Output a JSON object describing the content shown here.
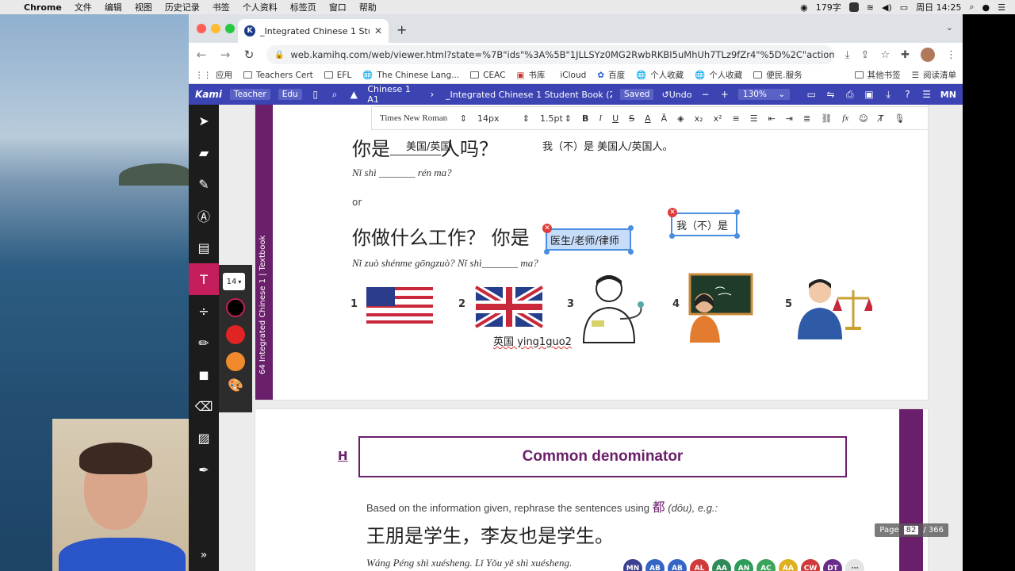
{
  "menubar": {
    "app_name": "Chrome",
    "items": [
      "文件",
      "编辑",
      "视图",
      "历史记录",
      "书签",
      "个人资料",
      "标签页",
      "窗口",
      "帮助"
    ],
    "speed": "179字",
    "clock": "周日 14:25"
  },
  "browser": {
    "tab_title": "_Integrated Chinese 1 Student",
    "url": "web.kamihq.com/web/viewer.html?state=%7B\"ids\"%3A%5B\"1JLLSYz0MG2RwbRKBI5uMhUh7TLz9fZr4\"%5D%2C\"action\"%3A\"op...",
    "bookmarks": [
      "应用",
      "Teachers Cert",
      "EFL",
      "The Chinese Lang...",
      "CEAC",
      "书库",
      "iCloud",
      "百度",
      "个人收藏",
      "个人收藏",
      "便民.服务"
    ],
    "bookmarks_right": [
      "其他书签",
      "阅读清单"
    ]
  },
  "kami": {
    "logo": "Kami",
    "role_teacher": "Teacher",
    "role_edu": "Edu",
    "course": "Chinese 1 A1",
    "filename": "_Integrated Chinese 1 Student Book (2).pdf",
    "saved": "Saved",
    "undo": "Undo",
    "zoom": "130%",
    "user_initials": "MN"
  },
  "richtext": {
    "font": "Times New Roman",
    "size": "14px",
    "line": "1.5pt"
  },
  "text_panel": {
    "size": "14",
    "colors": [
      "#000000",
      "#e02424",
      "#f08a2c"
    ]
  },
  "page1": {
    "sidebar_label": "64  Integrated Chinese 1  |  Textbook",
    "q1_zh_prefix": "你是",
    "q1_answer": "美国/英国",
    "q1_zh_suffix": "人吗？",
    "q1_response": "我（不）是 美国人/英国人。",
    "q1_pinyin": "Nǐ shì _______ rén ma?",
    "or": "or",
    "q2_zh_prefix": "你做什么工作？ 你是",
    "q2_zh_suffix": "吗？",
    "q2_answer": "医生/老师/律师",
    "q2_response": "我（不）是",
    "q2_pinyin": "Nǐ zuò shénme gōngzuò? Nǐ shì_______ ma?",
    "items": [
      "1",
      "2",
      "3",
      "4",
      "5"
    ],
    "uk_label": "英国 ying1guo2"
  },
  "page2": {
    "section": "H",
    "title": "Common denominator",
    "instruction_a": "Based on the information given, rephrase the sentences using",
    "instruction_zh": "都",
    "instruction_b": "(dōu), e.g.:",
    "example_zh": "王朋是学生，李友也是学生。",
    "example_pinyin": "Wáng Péng shì xuésheng. Lǐ Yǒu yě shì xuésheng."
  },
  "pagination": {
    "label": "Page",
    "current": "82",
    "total": "/ 366"
  },
  "avatars": [
    {
      "initials": "MN",
      "color": "#3b3f8f"
    },
    {
      "initials": "AB",
      "color": "#3566c4"
    },
    {
      "initials": "AB",
      "color": "#3566c4"
    },
    {
      "initials": "AL",
      "color": "#d03a3a"
    },
    {
      "initials": "AA",
      "color": "#2e8b57"
    },
    {
      "initials": "AN",
      "color": "#2e9b5a"
    },
    {
      "initials": "AC",
      "color": "#3aa55a"
    },
    {
      "initials": "AA",
      "color": "#e0b020"
    },
    {
      "initials": "CW",
      "color": "#d03a3a"
    },
    {
      "initials": "DT",
      "color": "#6a2a8a"
    }
  ]
}
